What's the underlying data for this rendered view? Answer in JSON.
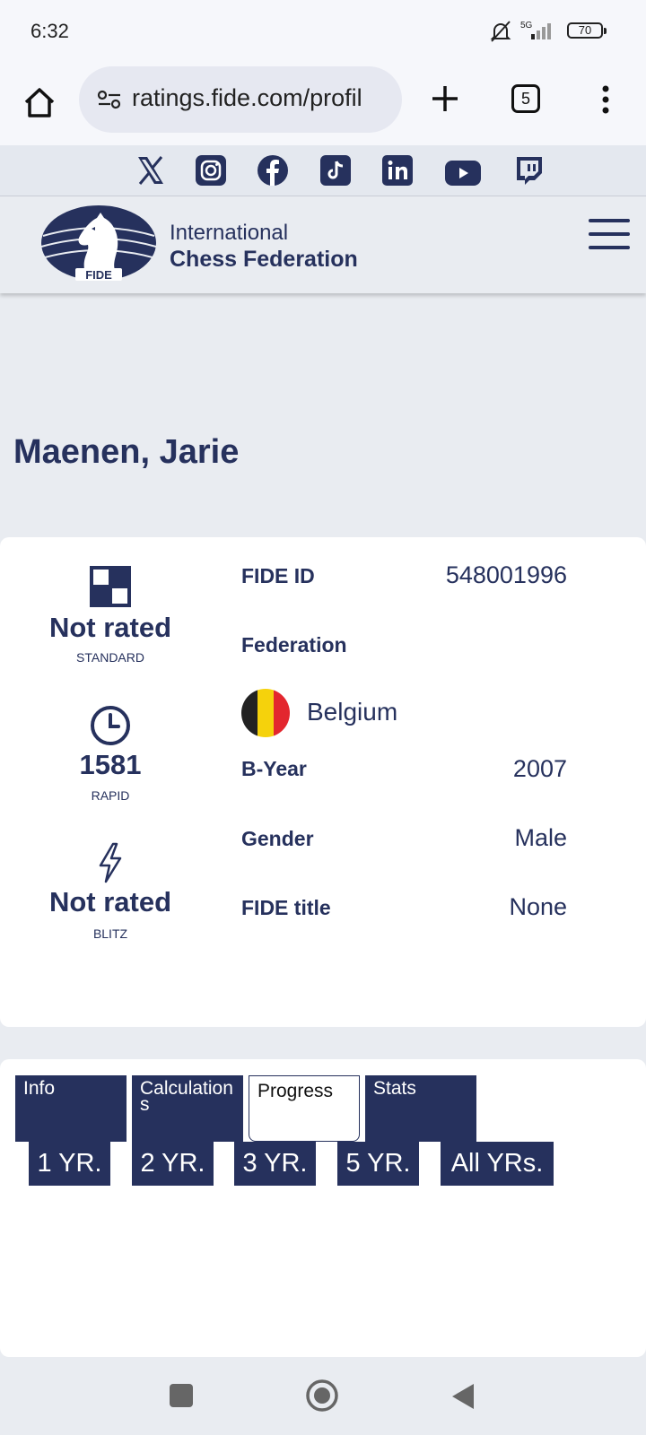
{
  "status": {
    "time": "6:32",
    "network": "5G",
    "battery": "70"
  },
  "browser": {
    "url": "ratings.fide.com/profil",
    "tab_count": "5"
  },
  "social": [
    "x-icon",
    "instagram-icon",
    "facebook-icon",
    "tiktok-icon",
    "linkedin-icon",
    "youtube-icon",
    "twitch-icon"
  ],
  "header": {
    "logo_text": "FIDE",
    "org_line1": "International",
    "org_line2": "Chess Federation"
  },
  "player": {
    "name": "Maenen, Jarie",
    "ratings": [
      {
        "value": "Not rated",
        "caption": "STANDARD"
      },
      {
        "value": "1581",
        "caption": "RAPID"
      },
      {
        "value": "Not rated",
        "caption": "BLITZ"
      }
    ],
    "details": {
      "fide_id_label": "FIDE ID",
      "fide_id": "548001996",
      "federation_label": "Federation",
      "federation": "Belgium",
      "byear_label": "B-Year",
      "byear": "2007",
      "gender_label": "Gender",
      "gender": "Male",
      "title_label": "FIDE title",
      "title": "None"
    }
  },
  "tabs": [
    {
      "label": "Info"
    },
    {
      "label": "Calculations"
    },
    {
      "label": "Progress"
    },
    {
      "label": "Stats"
    }
  ],
  "ranges": [
    "1 YR.",
    "2 YR.",
    "3 YR.",
    "5 YR.",
    "All YRs."
  ],
  "colors": {
    "brand": "#26315d",
    "flag_black": "#222222",
    "flag_yellow": "#f5d20c",
    "flag_red": "#e3262e"
  }
}
